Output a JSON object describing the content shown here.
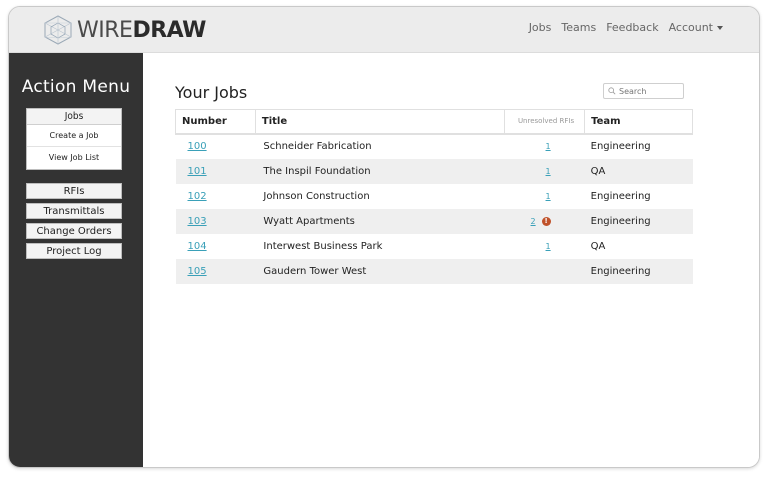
{
  "brand": {
    "thin": "WIRE",
    "bold": "DRAW"
  },
  "topnav": {
    "jobs": "Jobs",
    "teams": "Teams",
    "feedback": "Feedback",
    "account": "Account"
  },
  "sidebar": {
    "title": "Action Menu",
    "jobs": {
      "label": "Jobs",
      "create": "Create a Job",
      "view": "View Job List"
    },
    "rfis": "RFIs",
    "transmittals": "Transmittals",
    "change_orders": "Change Orders",
    "project_log": "Project Log"
  },
  "main": {
    "title": "Your Jobs",
    "search_placeholder": "Search",
    "columns": {
      "number": "Number",
      "title": "Title",
      "rfis": "Unresolved RFIs",
      "team": "Team"
    },
    "rows": [
      {
        "number": "100",
        "title": "Schneider Fabrication",
        "rfis": "1",
        "alert": "",
        "team": "Engineering"
      },
      {
        "number": "101",
        "title": "The Inspil Foundation",
        "rfis": "1",
        "alert": "",
        "team": "QA"
      },
      {
        "number": "102",
        "title": "Johnson Construction",
        "rfis": "1",
        "alert": "",
        "team": "Engineering"
      },
      {
        "number": "103",
        "title": "Wyatt Apartments",
        "rfis": "2",
        "alert": "!",
        "team": "Engineering"
      },
      {
        "number": "104",
        "title": "Interwest Business Park",
        "rfis": "1",
        "alert": "",
        "team": "QA"
      },
      {
        "number": "105",
        "title": "Gaudern Tower West",
        "rfis": "",
        "alert": "",
        "team": "Engineering"
      }
    ]
  },
  "colors": {
    "sidebar": "#333333",
    "link": "#3aa0b8",
    "alert": "#c0522a",
    "topbar": "#ececec"
  }
}
